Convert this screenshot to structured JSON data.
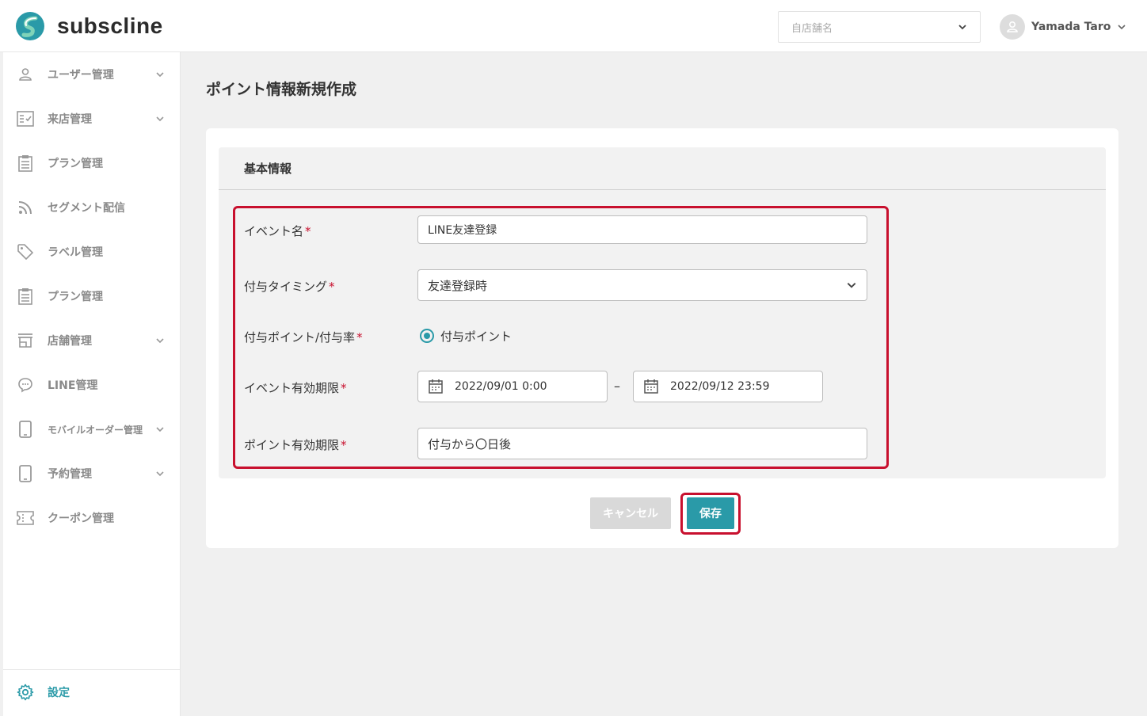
{
  "app": {
    "name": "subscline",
    "brand_color": "#2a9aa8",
    "highlight_color": "#c8102e"
  },
  "header": {
    "store_select": {
      "placeholder": "自店舗名"
    },
    "user": {
      "name": "Yamada Taro"
    }
  },
  "sidebar": {
    "items": [
      {
        "label": "ユーザー管理",
        "icon": "user-icon",
        "expandable": true
      },
      {
        "label": "来店管理",
        "icon": "checklist-icon",
        "expandable": true
      },
      {
        "label": "プラン管理",
        "icon": "clipboard-icon",
        "expandable": false
      },
      {
        "label": "セグメント配信",
        "icon": "rss-icon",
        "expandable": false
      },
      {
        "label": "ラベル管理",
        "icon": "tag-icon",
        "expandable": false
      },
      {
        "label": "プラン管理",
        "icon": "clipboard-icon",
        "expandable": false
      },
      {
        "label": "店舗管理",
        "icon": "store-icon",
        "expandable": true
      },
      {
        "label": "LINE管理",
        "icon": "chat-icon",
        "expandable": false
      },
      {
        "label": "モバイルオーダー管理",
        "icon": "mobile-icon",
        "expandable": true
      },
      {
        "label": "予約管理",
        "icon": "mobile-icon",
        "expandable": true
      },
      {
        "label": "クーポン管理",
        "icon": "coupon-icon",
        "expandable": false
      }
    ],
    "settings": {
      "label": "設定",
      "icon": "gear-icon"
    }
  },
  "main": {
    "title": "ポイント情報新規作成",
    "section_title": "基本情報",
    "form": {
      "event_name": {
        "label": "イベント名",
        "value": "LINE友達登録"
      },
      "timing": {
        "label": "付与タイミング",
        "value": "友達登録時"
      },
      "point_type": {
        "label": "付与ポイント/付与率",
        "option": "付与ポイント"
      },
      "event_period": {
        "label": "イベント有効期限",
        "start": "2022/09/01 0:00",
        "separator": "–",
        "end": "2022/09/12 23:59"
      },
      "point_expiry": {
        "label": "ポイント有効期限",
        "value": "付与から〇日後"
      },
      "required_mark": "*"
    },
    "buttons": {
      "cancel": "キャンセル",
      "save": "保存"
    }
  }
}
